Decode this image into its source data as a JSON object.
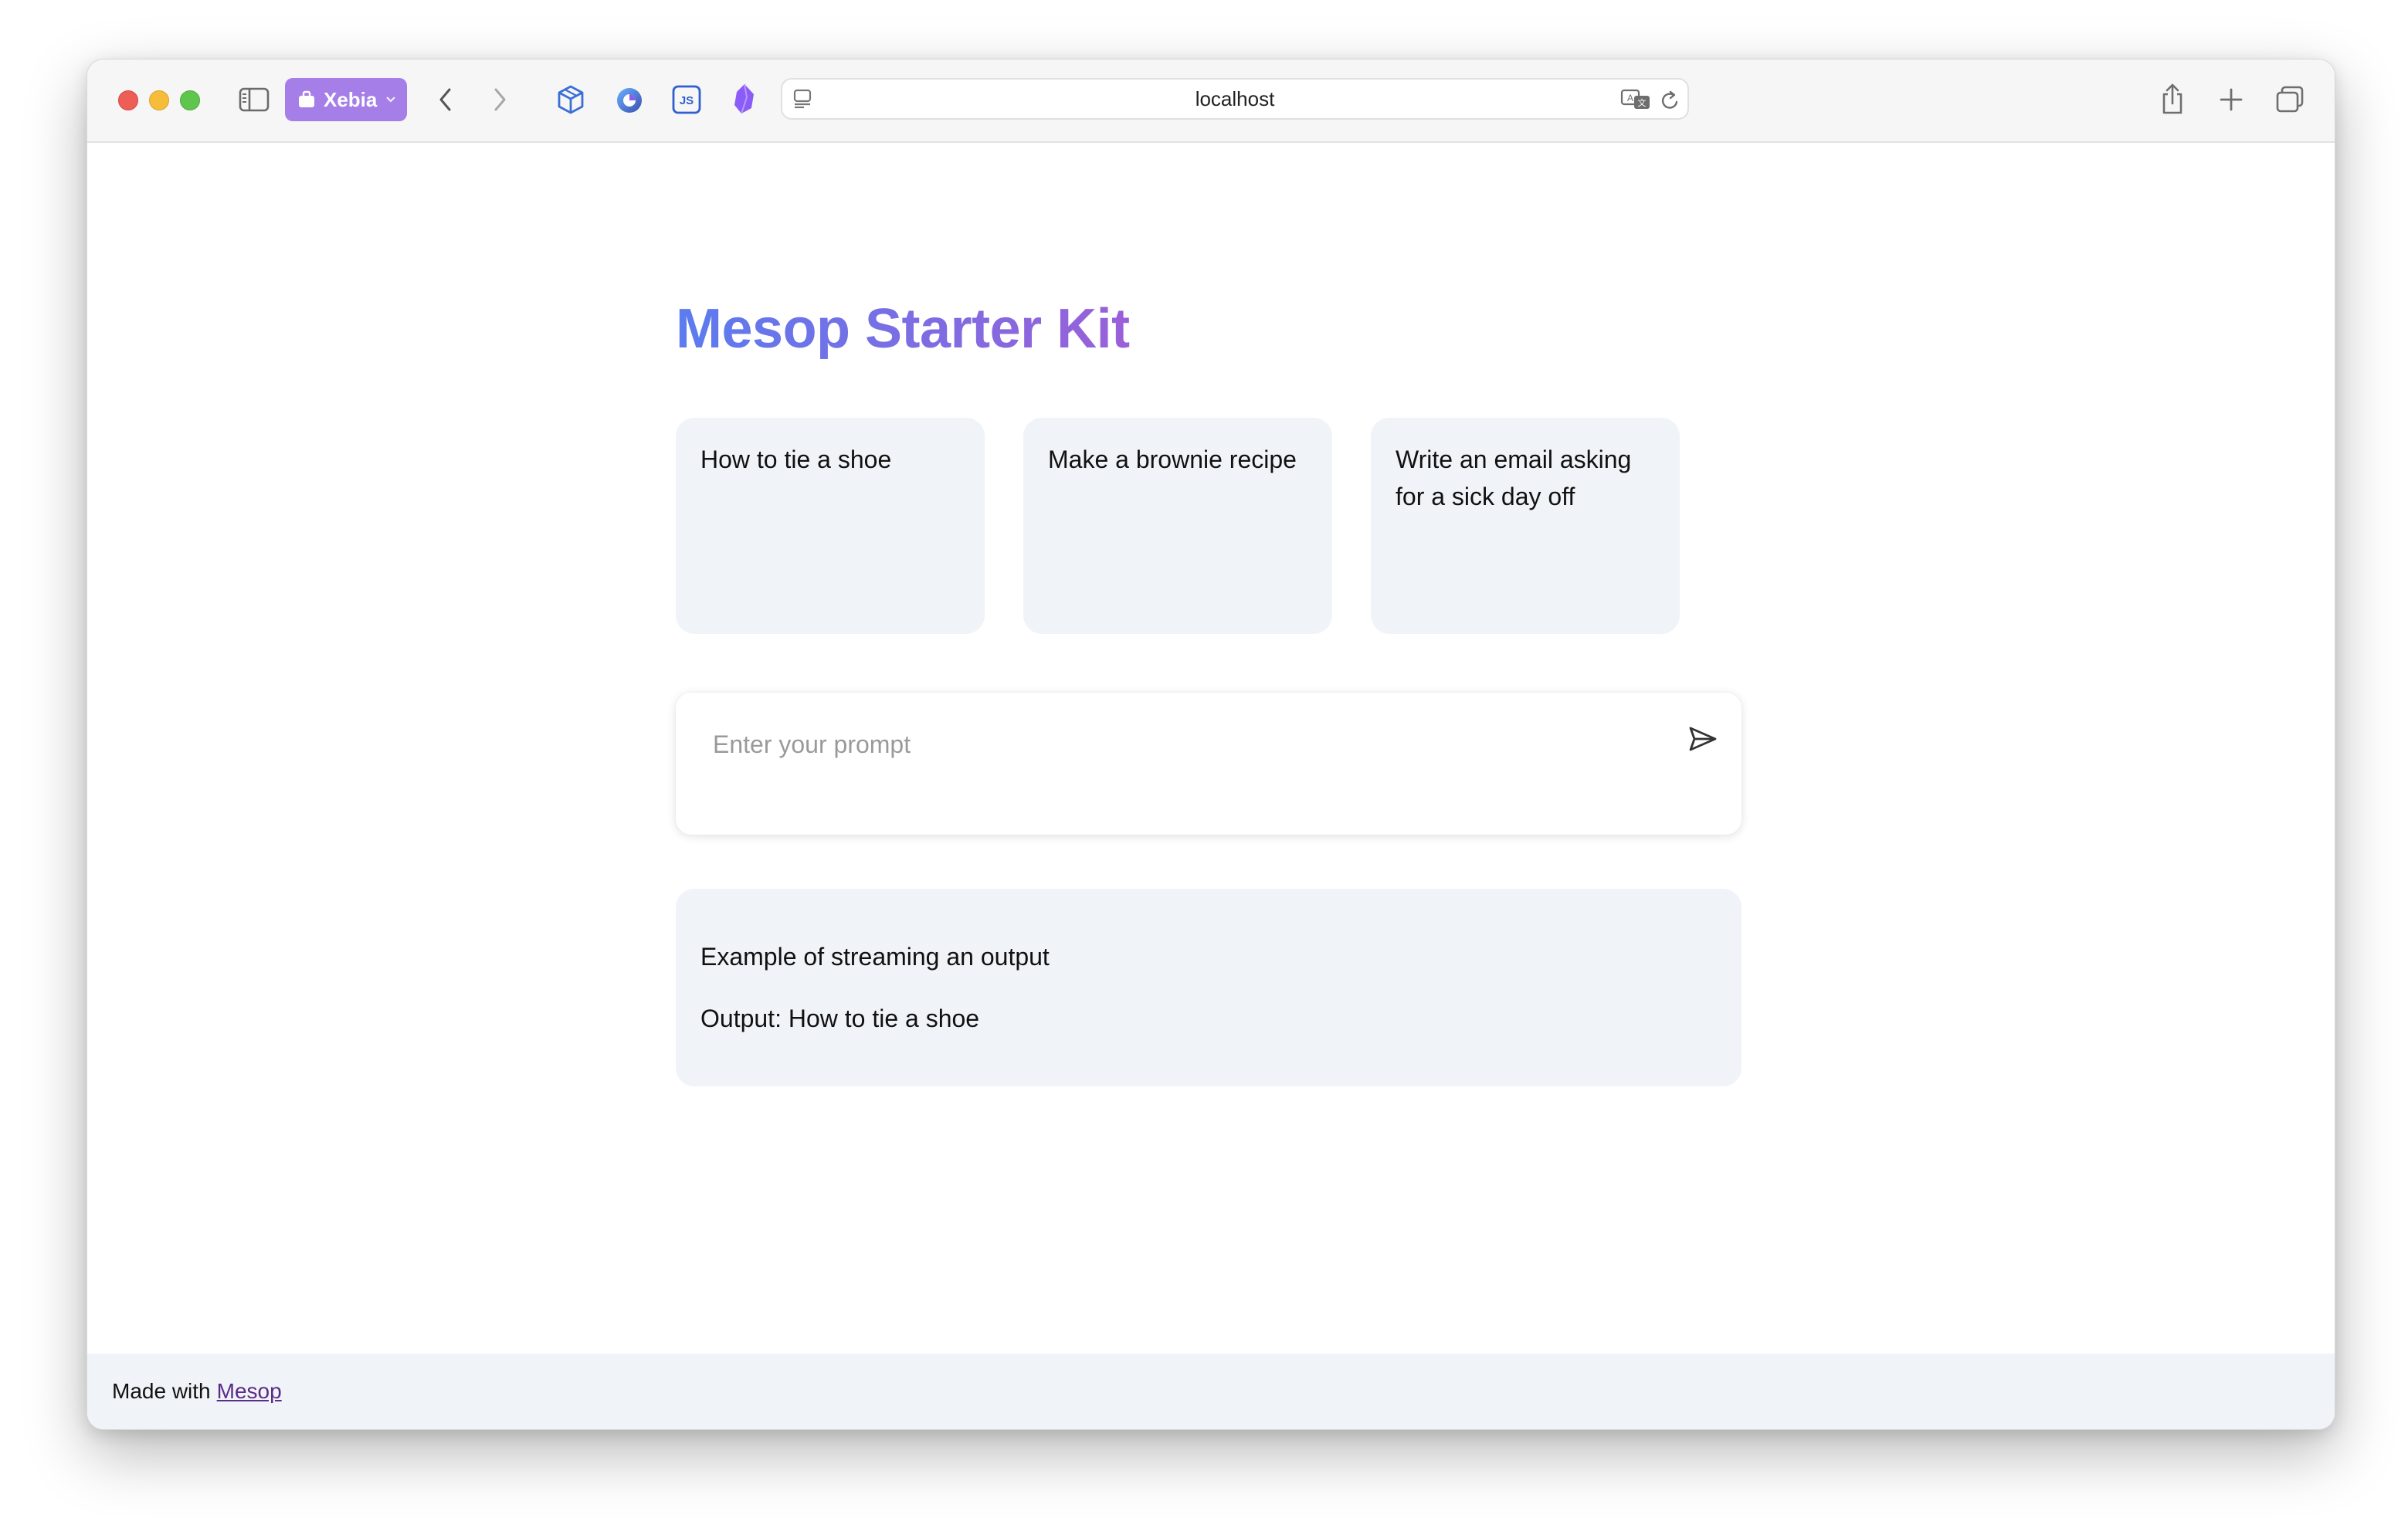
{
  "browser": {
    "profile_label": "Xebia",
    "address": "localhost",
    "extensions": [
      "cube-icon",
      "firefox-relay-icon",
      "js-icon",
      "obsidian-icon"
    ]
  },
  "page": {
    "title": "Mesop Starter Kit",
    "title_gradient": [
      "#5b7cef",
      "#9a60d8"
    ],
    "examples": [
      "How to tie a shoe",
      "Make a brownie recipe",
      "Write an email asking for a sick day off"
    ],
    "prompt": {
      "placeholder": "Enter your prompt",
      "value": ""
    },
    "output": {
      "heading": "Example of streaming an output",
      "text": "Output: How to tie a shoe"
    }
  },
  "footer": {
    "prefix": "Made with",
    "link_label": "Mesop"
  },
  "colors": {
    "card_bg": "#f0f4f8",
    "profile_pill": "#a57ee8",
    "link": "#5a2b8a"
  }
}
